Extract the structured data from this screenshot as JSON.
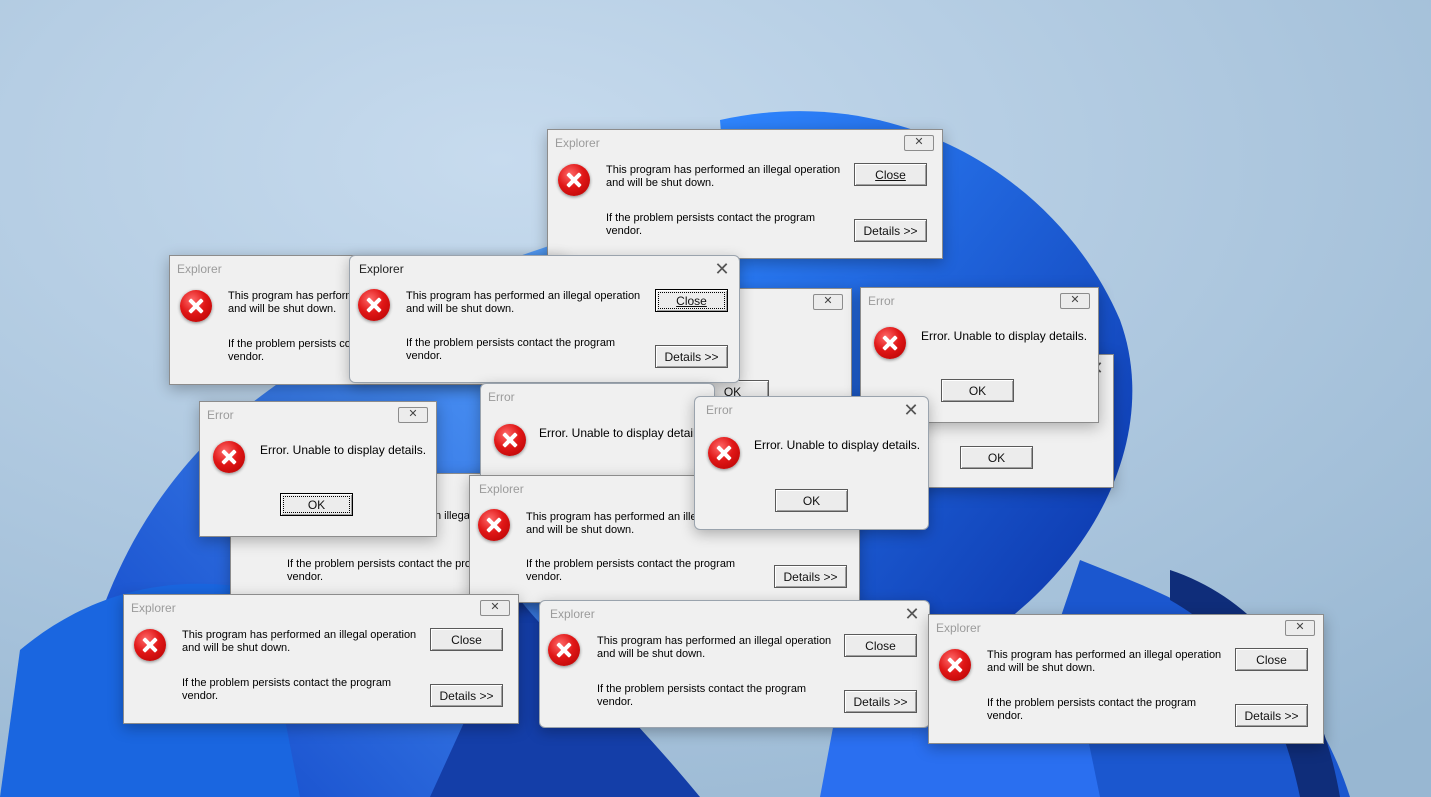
{
  "dialogs": {
    "illegal": {
      "title": "Explorer",
      "close_x": "✕",
      "line1": "This program has performed an illegal operation\nand will be shut down.",
      "line2": "If the problem persists contact the program\nvendor.",
      "close_label": "Close",
      "details_label": "Details >>"
    },
    "error": {
      "title": "Error",
      "close_x": "✕",
      "message": "Error. Unable to display details.",
      "ok_label": "OK"
    }
  },
  "icons": {
    "error": "error-x-icon"
  },
  "colors": {
    "dialog_bg": "#f0f0f0",
    "error_icon": "#e01717",
    "wallpaper_bg": "#a7c3dc",
    "bloom_blue": "#1f5ed8"
  }
}
